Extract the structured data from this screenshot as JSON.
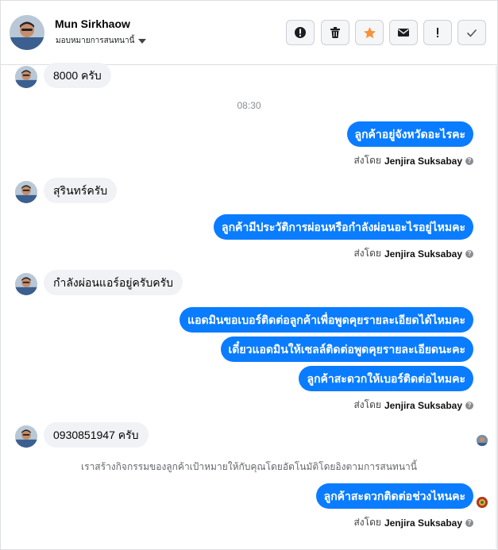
{
  "header": {
    "name": "Mun Sirkhaow",
    "assign_label": "มอบหมายการสนทนานี้",
    "actions": [
      {
        "icon": "alert-circle-icon"
      },
      {
        "icon": "trash-icon"
      },
      {
        "icon": "star-icon"
      },
      {
        "icon": "envelope-icon"
      },
      {
        "icon": "exclamation-icon"
      },
      {
        "icon": "check-icon"
      }
    ]
  },
  "colors": {
    "outgoing": "#0a7cff",
    "incoming": "#f0f2f5",
    "star": "#f7923a"
  },
  "messages": {
    "in1": "8000   ครับ",
    "time1": "08:30",
    "out1": "ลูกค้าอยู่จังหวัดอะไรคะ",
    "sent_prefix": "ส่งโดย",
    "sender": "Jenjira Suksabay",
    "in2": "สุรินทร์ครับ",
    "out2": "ลูกค้ามีประวัติการผ่อนหรือกำลังผ่อนอะไรอยู่ไหมคะ",
    "in3": "กำลังผ่อนแอร์อยู่ครับครับ",
    "out3": "แอดมินขอเบอร์ติดต่อลูกค้าเพื่อพูดคุยรายละเอียดได้ไหมคะ",
    "out4": "เดี๋ยวแอดมินให้เซลล์ติดต่อพูดคุยรายละเอียดนะคะ",
    "out5": "ลูกค้าสะดวกให้เบอร์ติดต่อไหมคะ",
    "in4": "0930851947  ครับ",
    "system": "เราสร้างกิจกรรมของลูกค้าเป้าหมายให้กับคุณโดยอัตโนมัติโดยอิงตามการสนทนานี้",
    "out6": "ลูกค้าสะดวกติดต่อช่วงไหนคะ"
  }
}
